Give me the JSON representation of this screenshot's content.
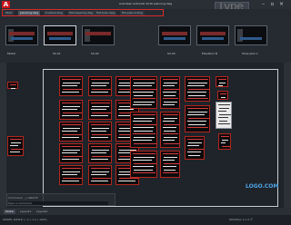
{
  "app": {
    "title": "Autodesk AutoCAD 2016  planning.dwg",
    "search_placeholder": "Type a keyword",
    "brand_color": "#c8151b"
  },
  "file_tabs": [
    {
      "label": "Start",
      "active": false
    },
    {
      "label": "planning.dwg",
      "active": true
    },
    {
      "label": "fr-stairs.dwg",
      "active": false
    },
    {
      "label": "flat-lowering.dwg",
      "active": false
    },
    {
      "label": "flat-hvac.dwg",
      "active": false
    },
    {
      "label": "fire-plan-d.dwg",
      "active": false
    }
  ],
  "thumbnails": [
    {
      "label": "Model",
      "selected": false
    },
    {
      "label": "Sh-01",
      "selected": true
    },
    {
      "label": "Sh-02",
      "selected": false
    },
    {
      "label": "Sh-03",
      "selected": false
    },
    {
      "label": "Elevation B",
      "selected": false
    },
    {
      "label": "Shop plan 1",
      "selected": false
    }
  ],
  "command_line": {
    "history": "Command:  _u  GROUP",
    "prompt": "Type a command"
  },
  "layout_tabs": [
    {
      "label": "Model",
      "active": true
    },
    {
      "label": "Layout1",
      "active": false
    },
    {
      "label": "Layout2",
      "active": false
    }
  ],
  "status": {
    "left": "MODEL  ####  ∟  ⊙  ⌖  1:1 / 100%",
    "right": "DECIMAL  1:1  0  ☰"
  },
  "watermark": "LOGO.COM"
}
